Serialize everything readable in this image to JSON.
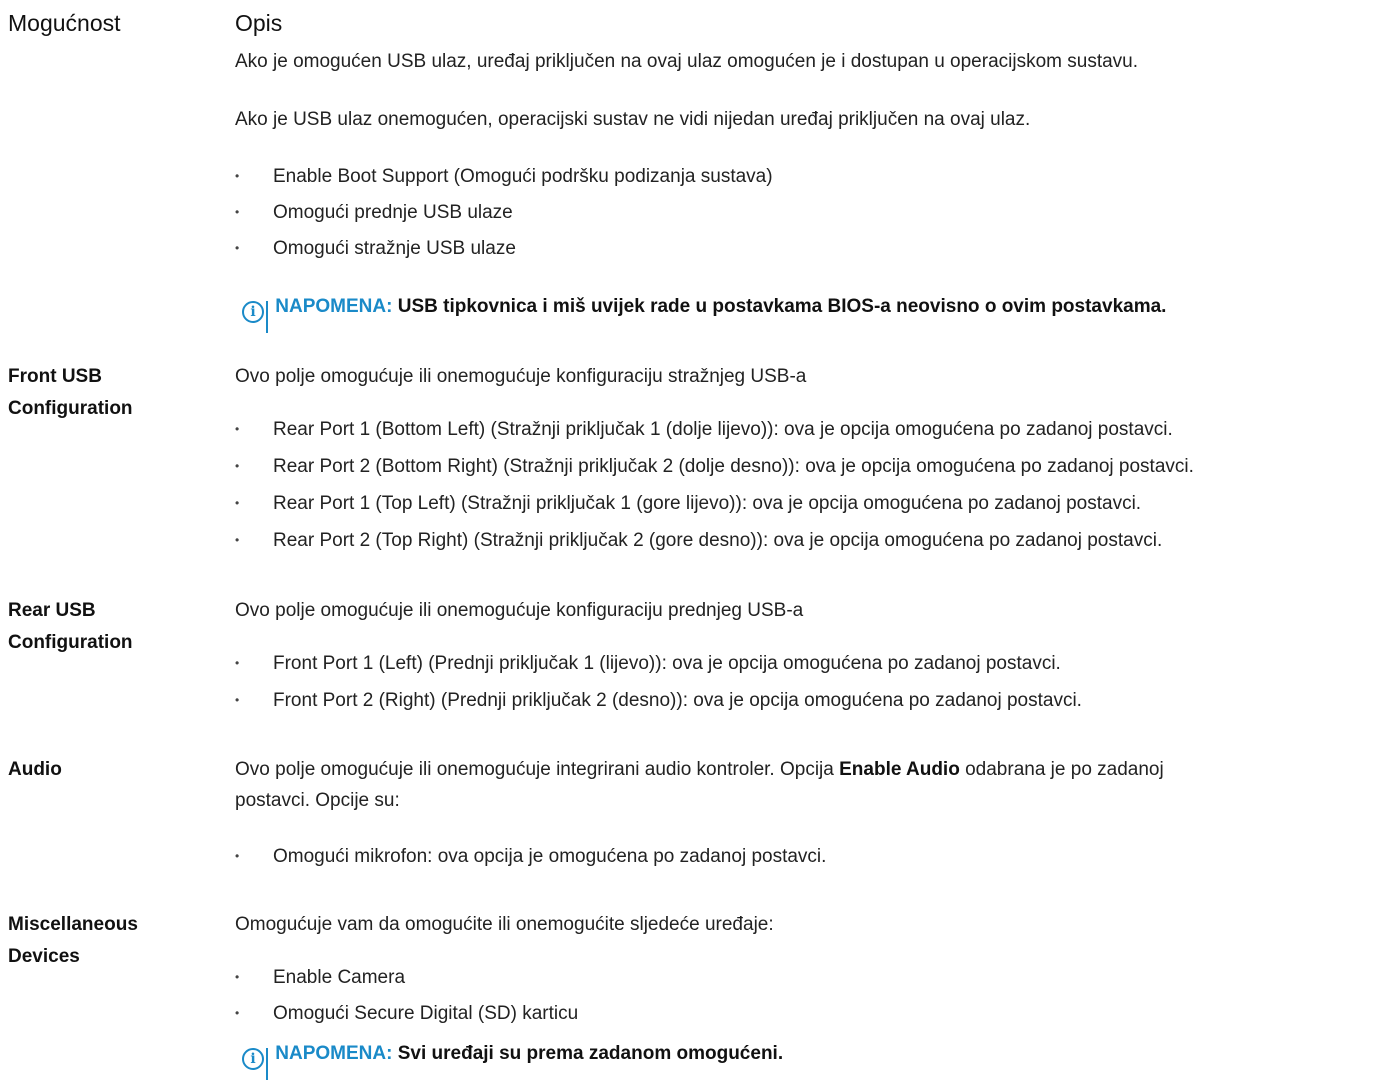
{
  "header": {
    "col1": "Mogućnost",
    "col2": "Opis"
  },
  "usb": {
    "para1": "Ako je omogućen USB ulaz, uređaj priključen na ovaj ulaz omogućen je i dostupan u operacijskom sustavu.",
    "para2": "Ako je USB ulaz onemogućen, operacijski sustav ne vidi nijedan uređaj priključen na ovaj ulaz.",
    "bullets": [
      "Enable Boot Support (Omogući podršku podizanja sustava)",
      "Omogući prednje USB ulaze",
      "Omogući stražnje USB ulaze"
    ],
    "note_label": "NAPOMENA:",
    "note_text": "USB tipkovnica i miš uvijek rade u postavkama BIOS-a neovisno o ovim postavkama."
  },
  "front_usb": {
    "label_line1": "Front USB",
    "label_line2": "Configuration",
    "desc": "Ovo polje omogućuje ili onemogućuje konfiguraciju stražnjeg USB-a",
    "bullets": [
      "Rear Port 1 (Bottom Left) (Stražnji priključak 1 (dolje lijevo)): ova je opcija omogućena po zadanoj postavci.",
      "Rear Port 2 (Bottom Right) (Stražnji priključak 2 (dolje desno)): ova je opcija omogućena po zadanoj postavci.",
      "Rear Port 1 (Top Left) (Stražnji priključak 1 (gore lijevo)): ova je opcija omogućena po zadanoj postavci.",
      "Rear Port 2 (Top Right) (Stražnji priključak 2 (gore desno)): ova je opcija omogućena po zadanoj postavci."
    ]
  },
  "rear_usb": {
    "label_line1": "Rear USB",
    "label_line2": "Configuration",
    "desc": "Ovo polje omogućuje ili onemogućuje konfiguraciju prednjeg USB-a",
    "bullets": [
      "Front Port 1 (Left) (Prednji priključak 1 (lijevo)): ova je opcija omogućena po zadanoj postavci.",
      "Front Port 2 (Right) (Prednji priključak 2 (desno)): ova je opcija omogućena po zadanoj postavci."
    ]
  },
  "audio": {
    "label": "Audio",
    "desc_before": "Ovo polje omogućuje ili onemogućuje integrirani audio kontroler. Opcija ",
    "desc_bold": "Enable Audio",
    "desc_after_line1": " odabrana je po zadanoj",
    "desc_line2": "postavci. Opcije su:",
    "bullets": [
      "Omogući mikrofon: ova opcija je omogućena po zadanoj postavci."
    ]
  },
  "misc": {
    "label_line1": "Miscellaneous",
    "label_line2": "Devices",
    "desc": "Omogućuje vam da omogućite ili onemogućite sljedeće uređaje:",
    "bullets": [
      "Enable Camera",
      "Omogući Secure Digital (SD) karticu"
    ],
    "note_label": "NAPOMENA:",
    "note_text": "Svi uređaji su prema zadanom omogućeni."
  },
  "colors": {
    "note_accent": "#1a8ac8",
    "text": "#222222"
  }
}
